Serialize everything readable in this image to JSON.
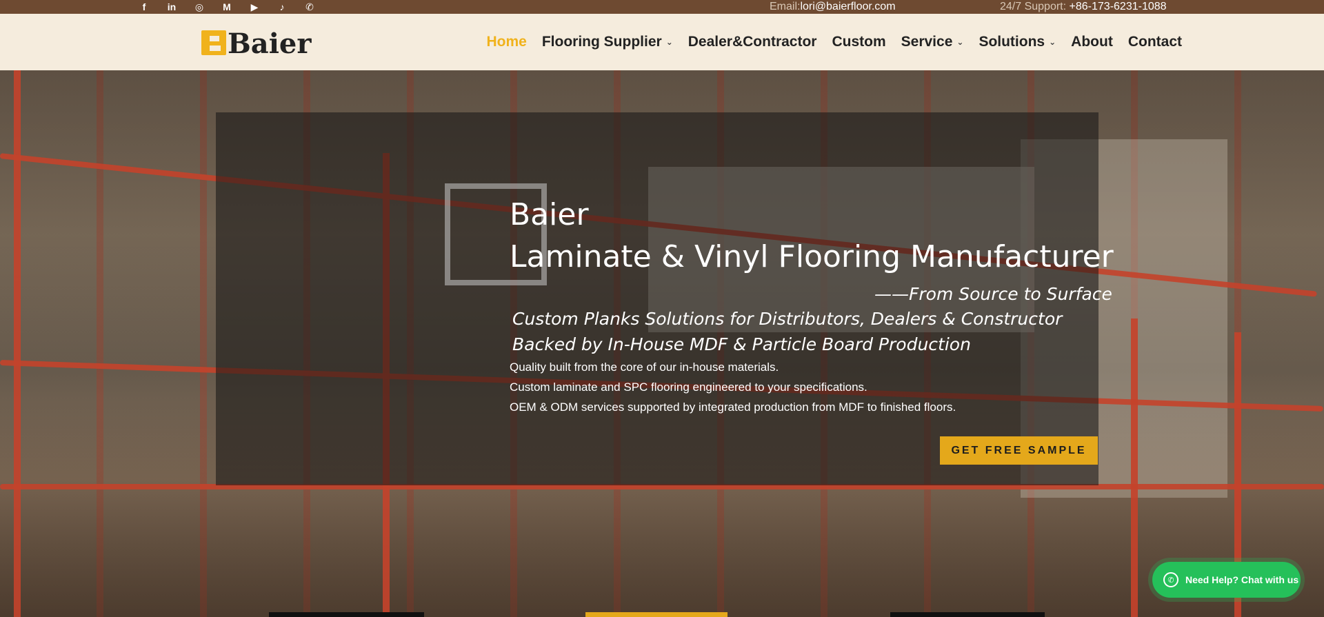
{
  "topbar": {
    "social": [
      {
        "icon": "facebook-icon",
        "glyph": "f"
      },
      {
        "icon": "linkedin-icon",
        "glyph": "in"
      },
      {
        "icon": "instagram-icon",
        "glyph": "◎"
      },
      {
        "icon": "medium-icon",
        "glyph": "M"
      },
      {
        "icon": "youtube-icon",
        "glyph": "▶"
      },
      {
        "icon": "tiktok-icon",
        "glyph": "♪"
      },
      {
        "icon": "whatsapp-icon",
        "glyph": "✆"
      }
    ],
    "email_label": "Email:",
    "email_value": "lori@baierfloor.com",
    "support_label": "24/7 Support:",
    "support_value": "+86-173-6231-1088"
  },
  "header": {
    "logo_text": "Baier",
    "nav": [
      {
        "label": "Home",
        "active": true,
        "dropdown": false
      },
      {
        "label": "Flooring Supplier",
        "active": false,
        "dropdown": true
      },
      {
        "label": "Dealer&Contractor",
        "active": false,
        "dropdown": false
      },
      {
        "label": "Custom",
        "active": false,
        "dropdown": false
      },
      {
        "label": "Service",
        "active": false,
        "dropdown": true
      },
      {
        "label": "Solutions",
        "active": false,
        "dropdown": true
      },
      {
        "label": "About",
        "active": false,
        "dropdown": false
      },
      {
        "label": "Contact",
        "active": false,
        "dropdown": false
      }
    ]
  },
  "hero": {
    "brand": "Baier",
    "title": "Laminate & Vinyl Flooring Manufacturer",
    "tagline": "——From Source to Surface",
    "subtitle1": "Custom Planks Solutions for Distributors, Dealers & Constructor",
    "subtitle2": "Backed by In-House MDF & Particle Board Production",
    "line1": "Quality built from the core of our in-house materials.",
    "line2": "Custom laminate and SPC flooring engineered to your specifications.",
    "line3": "OEM & ODM services supported by integrated production from MDF to finished floors.",
    "cta_label": "GET FREE SAMPLE"
  },
  "chat": {
    "label": "Need Help? Chat with us"
  },
  "colors": {
    "accent": "#f0b21c",
    "topbar": "#6e4a31",
    "header_bg": "#f5ecdd",
    "cta": "#e4a81b",
    "chat": "#25c05a"
  }
}
